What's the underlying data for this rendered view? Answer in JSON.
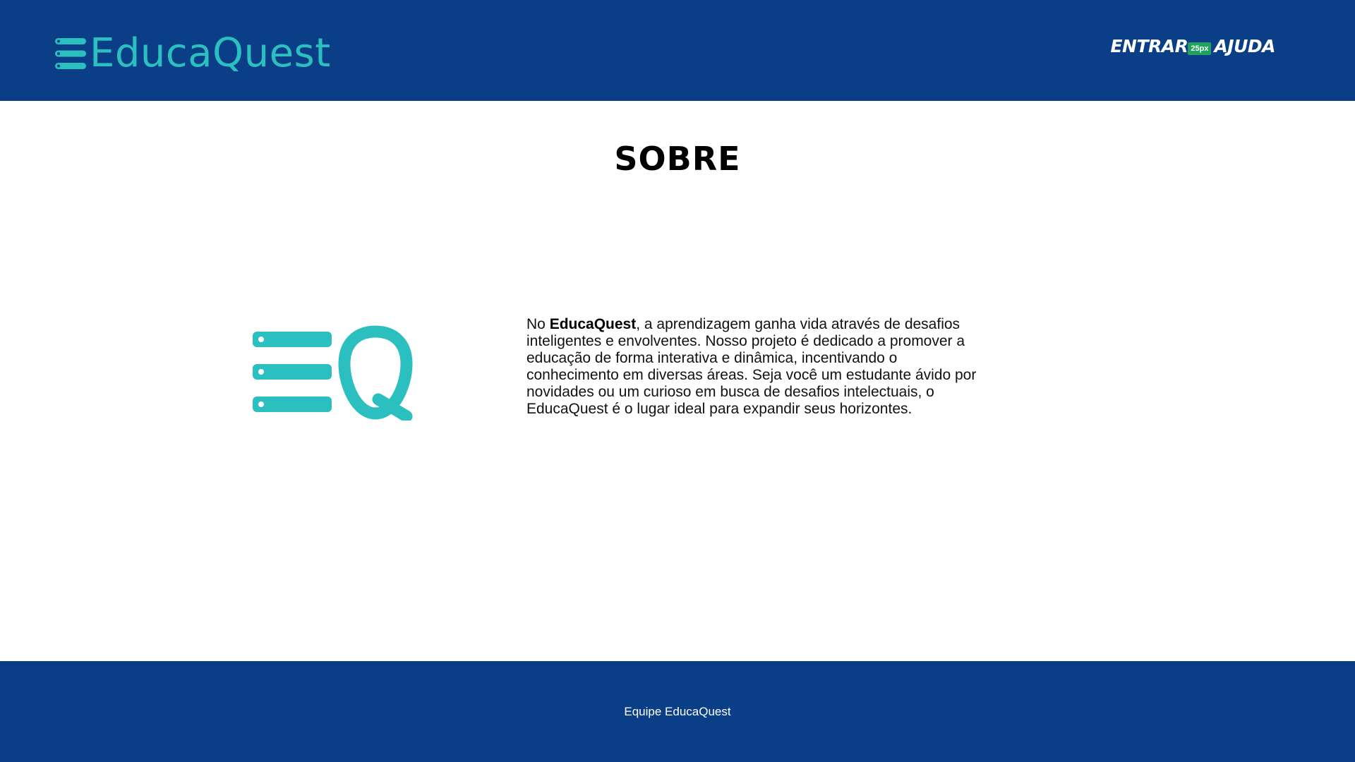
{
  "header": {
    "brand": "EducaQuest",
    "brand_icon": "menu-lines-logo-icon",
    "nav": {
      "login_label": "ENTRAR",
      "spacing_badge": "25px",
      "help_label": "AJUDA"
    }
  },
  "main": {
    "title": "SOBRE",
    "logo_icon": "eq-logo-icon",
    "about": {
      "intro": "No ",
      "brand": "EducaQuest",
      "body": ", a aprendizagem ganha vida através de desafios inteligentes e envolventes. Nosso projeto é dedicado a promover a educação de forma interativa e dinâmica, incentivando o conhecimento em diversas áreas. Seja você um estudante ávido por novidades ou um curioso em busca de desafios intelectuais, o EducaQuest é o lugar ideal para expandir seus horizontes."
    }
  },
  "footer": {
    "text": "Equipe EducaQuest"
  },
  "colors": {
    "header_bg": "#0a3f88",
    "accent": "#2cbfbf",
    "badge": "#1fa260"
  }
}
